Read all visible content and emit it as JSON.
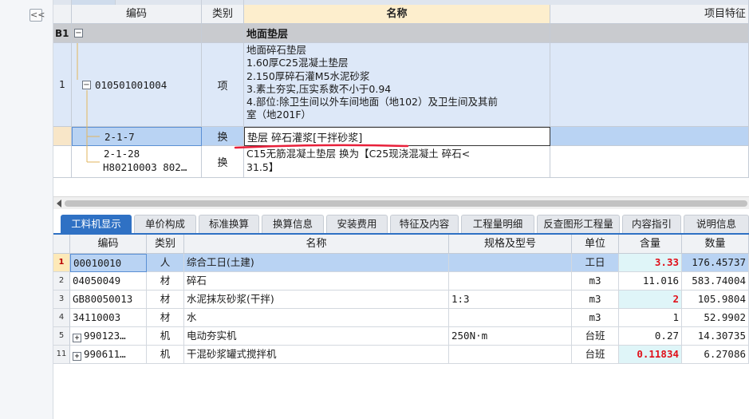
{
  "left_panel": {
    "collapse_label": "<<"
  },
  "top_grid": {
    "headers": {
      "code": "编码",
      "category": "类别",
      "name": "名称",
      "feature": "项目特征"
    },
    "rows": [
      {
        "num": "B1",
        "toggle": "−",
        "name": "地面垫层"
      },
      {
        "num": "1",
        "toggle": "−",
        "code": "010501001004",
        "category": "项",
        "name_lines": [
          "地面碎石垫层",
          "1.60厚C25混凝土垫层",
          "2.150厚碎石灌M5水泥砂浆",
          "3.素土夯实,压实系数不小于0.94",
          "4.部位:除卫生间以外车间地面（地102）及卫生间及其前",
          "室（地201F）"
        ]
      },
      {
        "num": "",
        "code": "2-1-7",
        "category": "换",
        "name": "垫层 碎石灌浆[干拌砂浆]"
      },
      {
        "num": "",
        "code_lines": [
          "2-1-28",
          "H80210003 802…"
        ],
        "category": "换",
        "name_lines": [
          "C15无筋混凝土垫层  换为【C25现浇混凝土 碎石<",
          "31.5】"
        ]
      }
    ]
  },
  "tabs": [
    "工料机显示",
    "单价构成",
    "标准换算",
    "换算信息",
    "安装费用",
    "特征及内容",
    "工程量明细",
    "反查图形工程量",
    "内容指引",
    "说明信息"
  ],
  "bottom_grid": {
    "headers": {
      "code": "编码",
      "category": "类别",
      "name": "名称",
      "spec": "规格及型号",
      "unit": "单位",
      "content": "含量",
      "qty": "数量"
    },
    "rows": [
      {
        "num": "1",
        "code": "00010010",
        "category": "人",
        "name": "综合工日(土建)",
        "spec": "",
        "unit": "工日",
        "content": "3.33",
        "qty": "176.45737"
      },
      {
        "num": "2",
        "code": "04050049",
        "category": "材",
        "name": "碎石",
        "spec": "",
        "unit": "m3",
        "content": "11.016",
        "qty": "583.74004"
      },
      {
        "num": "3",
        "code": "GB80050013",
        "category": "材",
        "name": "水泥抹灰砂浆(干拌)",
        "spec": "1:3",
        "unit": "m3",
        "content": "2",
        "qty": "105.9804"
      },
      {
        "num": "4",
        "code": "34110003",
        "category": "材",
        "name": "水",
        "spec": "",
        "unit": "m3",
        "content": "1",
        "qty": "52.9902"
      },
      {
        "num": "5",
        "toggle": "+",
        "code": "990123…",
        "category": "机",
        "name": "电动夯实机",
        "spec": "250N·m",
        "unit": "台班",
        "content": "0.27",
        "qty": "14.30735"
      },
      {
        "num": "11",
        "toggle": "+",
        "code": "990611…",
        "category": "机",
        "name": "干混砂浆罐式搅拌机",
        "spec": "",
        "unit": "台班",
        "content": "0.11834",
        "qty": "6.27086"
      }
    ]
  },
  "colors": {
    "accent": "#2f71c4",
    "selected_row": "#b9d3f3",
    "highlight_red": "#e0101a",
    "underline_red": "#e8203a"
  }
}
